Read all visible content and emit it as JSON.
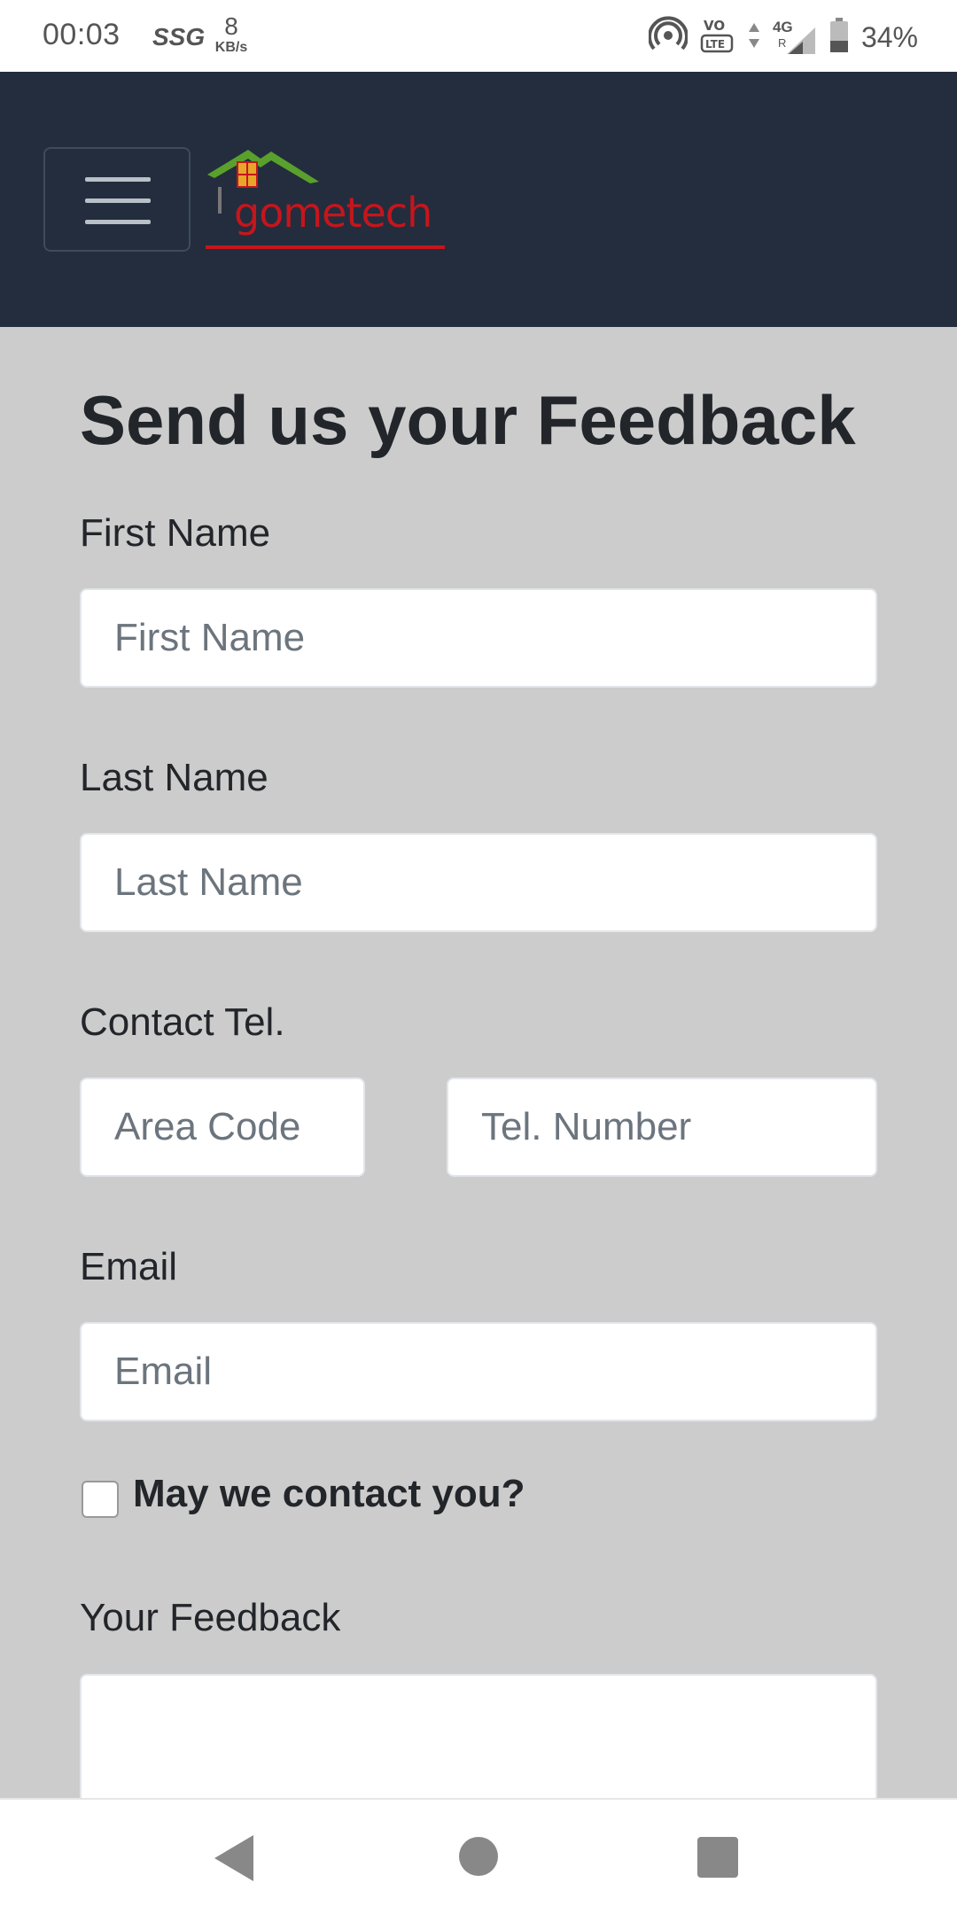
{
  "status_bar": {
    "time": "00:03",
    "carrier": "SSG",
    "net_speed_value": "8",
    "net_speed_unit": "KB/s",
    "icons": [
      "hotspot-icon",
      "volte-icon",
      "data-arrows-icon",
      "signal-4g-icon",
      "battery-icon"
    ],
    "network_type": "4G",
    "roaming": "R",
    "battery_percent": "34%"
  },
  "header": {
    "menu_icon": "hamburger-icon",
    "logo_text": "gometech",
    "colors": {
      "background": "#232d3e",
      "logo_red": "#c4161c",
      "roof_green": "#5aa02c"
    }
  },
  "form": {
    "title": "Send us your Feedback",
    "first_name_label": "First Name",
    "first_name_placeholder": "First Name",
    "last_name_label": "Last Name",
    "last_name_placeholder": "Last Name",
    "contact_label": "Contact Tel.",
    "area_code_placeholder": "Area Code",
    "tel_number_placeholder": "Tel. Number",
    "email_label": "Email",
    "email_placeholder": "Email",
    "contact_consent_label": "May we contact you?",
    "contact_consent_checked": false,
    "feedback_label": "Your Feedback",
    "feedback_value": ""
  },
  "system_nav": {
    "back": "back-icon",
    "home": "home-icon",
    "recent": "recent-apps-icon"
  }
}
